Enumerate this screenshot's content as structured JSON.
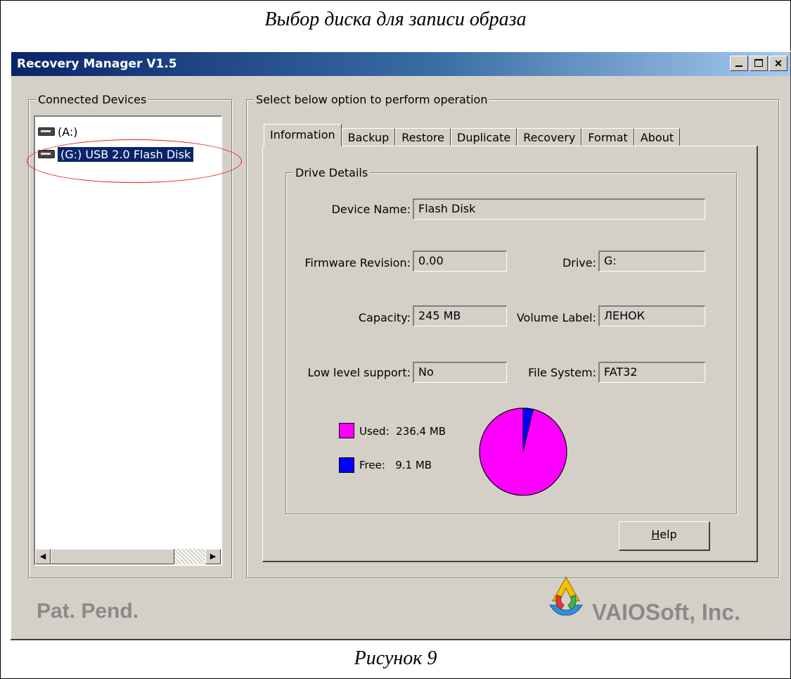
{
  "document": {
    "caption_top": "Выбор диска для записи образа",
    "caption_bottom": "Рисунок 9"
  },
  "window": {
    "title": "Recovery Manager V1.5",
    "controls": [
      "minimize",
      "maximize",
      "close"
    ]
  },
  "devices_panel": {
    "label": "Connected Devices",
    "items": [
      {
        "label": "(A:)",
        "selected": false,
        "icon": "drive-icon"
      },
      {
        "label": "(G:) USB 2.0  Flash Disk",
        "selected": true,
        "icon": "drive-icon"
      }
    ]
  },
  "operations_panel": {
    "label": "Select below option to perform operation",
    "tabs": [
      {
        "label": "Information",
        "active": true
      },
      {
        "label": "Backup",
        "active": false
      },
      {
        "label": "Restore",
        "active": false
      },
      {
        "label": "Duplicate",
        "active": false
      },
      {
        "label": "Recovery",
        "active": false
      },
      {
        "label": "Format",
        "active": false
      },
      {
        "label": "About",
        "active": false
      }
    ]
  },
  "drive_details": {
    "label": "Drive Details",
    "device_name_label": "Device Name:",
    "device_name": "Flash Disk",
    "firmware_label": "Firmware Revision:",
    "firmware": "0.00",
    "drive_label": "Drive:",
    "drive": "G:",
    "capacity_label": "Capacity:",
    "capacity": "245 MB",
    "volume_label_label": "Volume Label:",
    "volume_label": "ЛЕНОК",
    "low_level_label": "Low level support:",
    "low_level": "No",
    "file_system_label": "File System:",
    "file_system": "FAT32"
  },
  "chart_data": {
    "type": "pie",
    "categories": [
      "Used",
      "Free"
    ],
    "values": [
      236.4,
      9.1
    ],
    "colors": [
      "#ff00ff",
      "#0000ff"
    ],
    "legend": [
      {
        "label": "Used:",
        "value_text": "236.4 MB"
      },
      {
        "label": "Free:",
        "value_text": "9.1 MB"
      }
    ],
    "unit": "MB"
  },
  "help_button": {
    "label_accel": "H",
    "label_rest": "elp"
  },
  "footer": {
    "left_text": "Pat. Pend.",
    "brand_text": "VAIOSoft, Inc."
  }
}
